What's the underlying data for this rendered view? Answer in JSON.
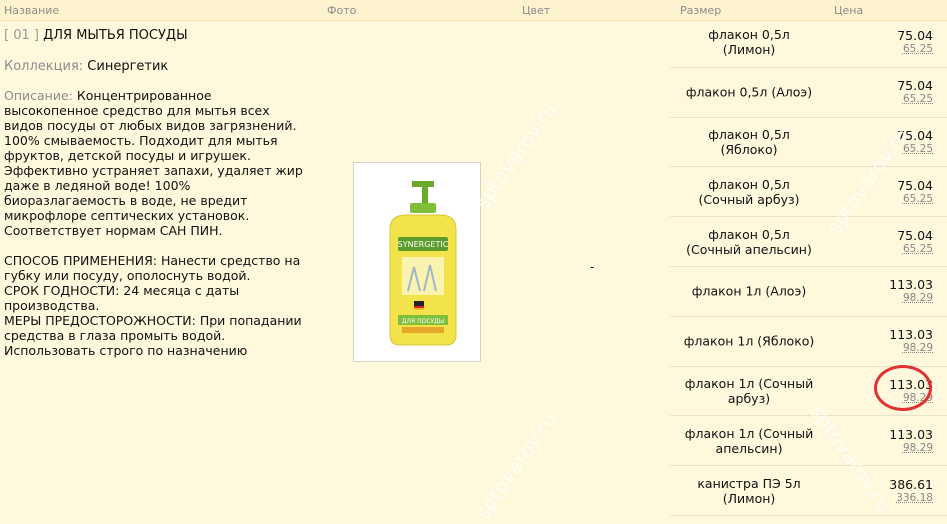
{
  "header": {
    "name": "Название",
    "photo": "Фото",
    "color": "Цвет",
    "size": "Размер",
    "price": "Цена"
  },
  "product": {
    "number": "[ 01 ]",
    "title": "ДЛЯ МЫТЬЯ ПОСУДЫ",
    "collection_label": "Коллекция:",
    "collection_value": "Синергетик",
    "description_label": "Описание:",
    "description_text": "Концентрированное\nвысокопенное средство для мытья всех\nвидов посуды от любых видов загрязнений.\n100% смываемость. Подходит для мытья\nфруктов, детской посуды и игрушек.\nЭффективно устраняет запахи, удаляет жир\nдаже в ледяной воде! 100%\nбиоразлагаемость в воде, не вредит\nмикрофлоре септических установок.\nСоответствует нормам САН ПИН.\n\nСПОСОБ ПРИМЕНЕНИЯ: Нанести средство на\nгубку или посуду, ополоснуть водой.\nСРОК ГОДНОСТИ: 24 месяца с даты\nпроизводства.\nМЕРЫ ПРЕДОСТОРОЖНОСТИ: При попадании\nсредства в глаза промыть водой.\nИспользовать строго по назначению",
    "color_value": "-",
    "bottle_brand": "SYNERGETIC",
    "bottle_label": "ДЛЯ ПОСУДЫ"
  },
  "sizes": [
    {
      "label": "флакон 0,5л\n(Лимон)",
      "price": "75.04",
      "old": "65.25"
    },
    {
      "label": "флакон 0,5л (Алоэ)",
      "price": "75.04",
      "old": "65.25"
    },
    {
      "label": "флакон 0,5л\n(Яблоко)",
      "price": "75.04",
      "old": "65.25"
    },
    {
      "label": "флакон 0,5л\n(Сочный арбуз)",
      "price": "75.04",
      "old": "65.25"
    },
    {
      "label": "флакон 0,5л\n(Сочный апельсин)",
      "price": "75.04",
      "old": "65.25"
    },
    {
      "label": "флакон 1л (Алоэ)",
      "price": "113.03",
      "old": "98.29"
    },
    {
      "label": "флакон 1л (Яблоко)",
      "price": "113.03",
      "old": "98.29"
    },
    {
      "label": "флакон 1л (Сочный\nарбуз)",
      "price": "113.03",
      "old": "98.29"
    },
    {
      "label": "флакон 1л (Сочный\nапельсин)",
      "price": "113.03",
      "old": "98.29"
    },
    {
      "label": "канистра ПЭ 5л\n(Лимон)",
      "price": "386.61",
      "old": "336.18"
    }
  ],
  "watermark": "sptovarov.ru",
  "colors": {
    "background": "#fff8dc",
    "highlight": "#e03131",
    "muted": "#8d8d8d"
  }
}
